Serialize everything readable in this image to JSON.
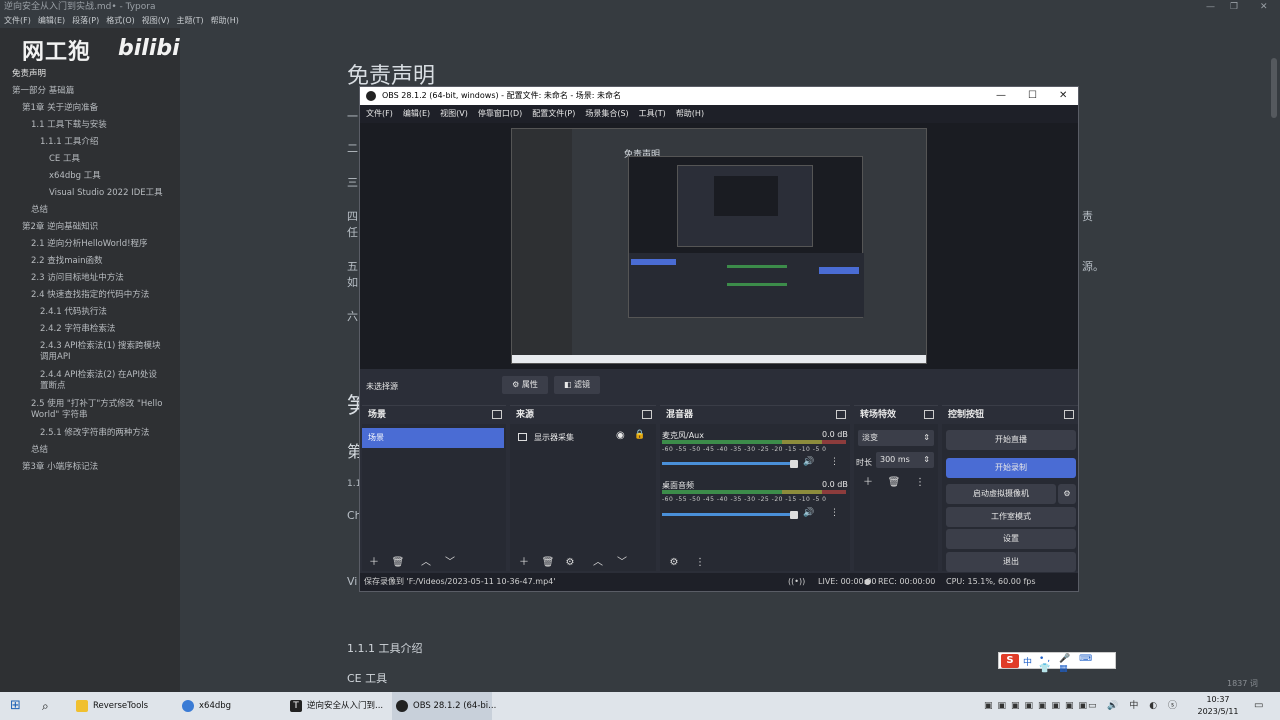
{
  "typora": {
    "title": "逆向安全从入门到实战.md• - Typora",
    "menu": [
      "文件(F)",
      "编辑(E)",
      "段落(P)",
      "格式(O)",
      "视图(V)",
      "主题(T)",
      "帮助(H)"
    ],
    "watermark": "网工狍",
    "toc": [
      "免责声明",
      "第一部分 基础篇",
      "第1章 关于逆向准备",
      "1.1 工具下载与安装",
      "1.1.1 工具介绍",
      "CE 工具",
      "x64dbg 工具",
      "Visual Studio 2022 IDE工具",
      "总结",
      "第2章 逆向基础知识",
      "2.1 逆向分析HelloWorld!程序",
      "2.2 查找main函数",
      "2.3 访问目标地址中方法",
      "2.4 快速查找指定的代码中方法",
      "2.4.1 代码执行法",
      "2.4.2 字符串检索法",
      "2.4.3 API检索法(1) 搜索跨模块",
      "调用API",
      "2.4.4 API检索法(2) 在API处设",
      "置断点",
      "2.5 使用 \"打补丁\"方式修改 \"Hello",
      "World\" 字符串",
      "2.5.1 修改字符串的两种方法",
      "总结",
      "第3章 小端序标记法"
    ],
    "editor": {
      "heading": "免责声明",
      "left_fragments": [
        "一",
        "二",
        "三",
        "四",
        "任",
        "五",
        "如",
        "六"
      ],
      "right_fragments": [
        "责",
        "源。"
      ],
      "bottom_left": [
        "笋",
        "第",
        "1.1",
        "Ch",
        "Vi"
      ],
      "sub_heading": "1.1.1 工具介绍",
      "sub_heading2": "CE 工具",
      "word_count": "1837 词"
    },
    "sidebar_footer": [
      "<",
      "</>"
    ]
  },
  "obs": {
    "title": "OBS 28.1.2 (64-bit, windows) - 配置文件: 未命名 - 场景: 未命名",
    "menu": [
      "文件(F)",
      "编辑(E)",
      "视图(V)",
      "停靠窗口(D)",
      "配置文件(P)",
      "场景集合(S)",
      "工具(T)",
      "帮助(H)"
    ],
    "preview_heading": "免责声明",
    "no_source": "未选择源",
    "properties_btn": "属性",
    "filters_btn": "滤镜",
    "docks": {
      "scenes": {
        "title": "场景",
        "items": [
          "场景"
        ]
      },
      "sources": {
        "title": "来源",
        "items": [
          "显示器采集"
        ]
      },
      "mixer": {
        "title": "混音器",
        "channels": [
          {
            "name": "麦克风/Aux",
            "db": "0.0 dB"
          },
          {
            "name": "桌面音频",
            "db": "0.0 dB"
          }
        ],
        "ticks": "-60 -55 -50 -45 -40 -35 -30 -25 -20 -15 -10 -5  0"
      },
      "transitions": {
        "title": "转场特效",
        "type": "淡变",
        "duration_label": "时长",
        "duration": "300 ms"
      },
      "controls": {
        "title": "控制按钮",
        "buttons": [
          "开始直播",
          "开始录制",
          "启动虚拟摄像机",
          "工作室模式",
          "设置",
          "退出"
        ]
      }
    },
    "status": {
      "saved": "保存录像到 'F:/Videos/2023-05-11 10-36-47.mp4'",
      "live": "LIVE: 00:00:00",
      "rec": "REC: 00:00:00",
      "cpu": "CPU: 15.1%, 60.00 fps"
    },
    "accent": "#4a6cd4"
  },
  "taskbar": {
    "apps": [
      "ReverseTools",
      "x64dbg",
      "逆向安全从入门到...",
      "OBS 28.1.2 (64-bi..."
    ],
    "time": "10:37",
    "date": "2023/5/11",
    "ime": "中"
  }
}
